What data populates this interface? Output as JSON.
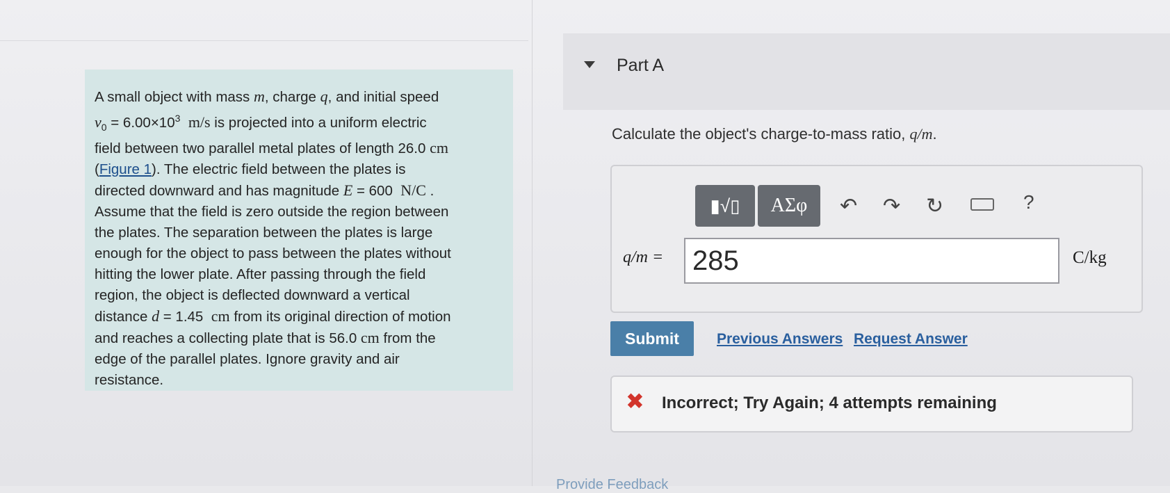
{
  "problem": {
    "line1_a": "A small object with mass ",
    "m": "m",
    "line1_b": ", charge ",
    "q": "q",
    "line1_c": ", and initial speed",
    "v0_sym": "v",
    "v0_sub": "0",
    "v0_eq": " = 6.00×10",
    "v0_exp": "3",
    "v0_unit": "m/s",
    "line2_b": " is projected into a uniform electric",
    "line3": "field between two parallel metal plates of length 26.0 ",
    "cm": "cm",
    "figure_link": "Figure 1",
    "line4_a": "(",
    "line4_b": "). The electric field between the plates is",
    "line5_a": "directed downward and has magnitude ",
    "E_sym": "E",
    "E_eq": " = 600 ",
    "E_unit": "N/C",
    "line5_end": " .",
    "rest_1": "Assume that the field is zero outside the region between",
    "rest_2": "the plates. The separation between the plates is large",
    "rest_3": "enough for the object to pass between the plates without",
    "rest_4": "hitting the lower plate. After passing through the field",
    "rest_5": "region, the object is deflected downward a vertical",
    "rest_6a": "distance ",
    "d_sym": "d",
    "d_eq": " = 1.45 ",
    "d_unit": "cm",
    "rest_6b": " from its original direction of motion",
    "rest_7a": "and reaches a collecting plate that is 56.0 ",
    "cm2": "cm",
    "rest_7b": " from the",
    "rest_8": "edge of the parallel plates. Ignore gravity and air",
    "rest_9": "resistance."
  },
  "part": {
    "title": "Part A"
  },
  "question": {
    "text": "Calculate the object's charge-to-mass ratio, ",
    "expr": "q/m",
    "end": "."
  },
  "toolbar": {
    "templates_label": "▮√▯",
    "symbols_label": "ΑΣφ",
    "help_label": "?"
  },
  "answer": {
    "label": "q/m =",
    "value": "285",
    "unit": "C/kg"
  },
  "actions": {
    "submit": "Submit",
    "previous_answers": "Previous Answers",
    "request_answer": "Request Answer"
  },
  "feedback": {
    "icon": "✖",
    "text": "Incorrect; Try Again; 4 attempts remaining"
  },
  "footer": {
    "text": "Provide Feedback"
  }
}
